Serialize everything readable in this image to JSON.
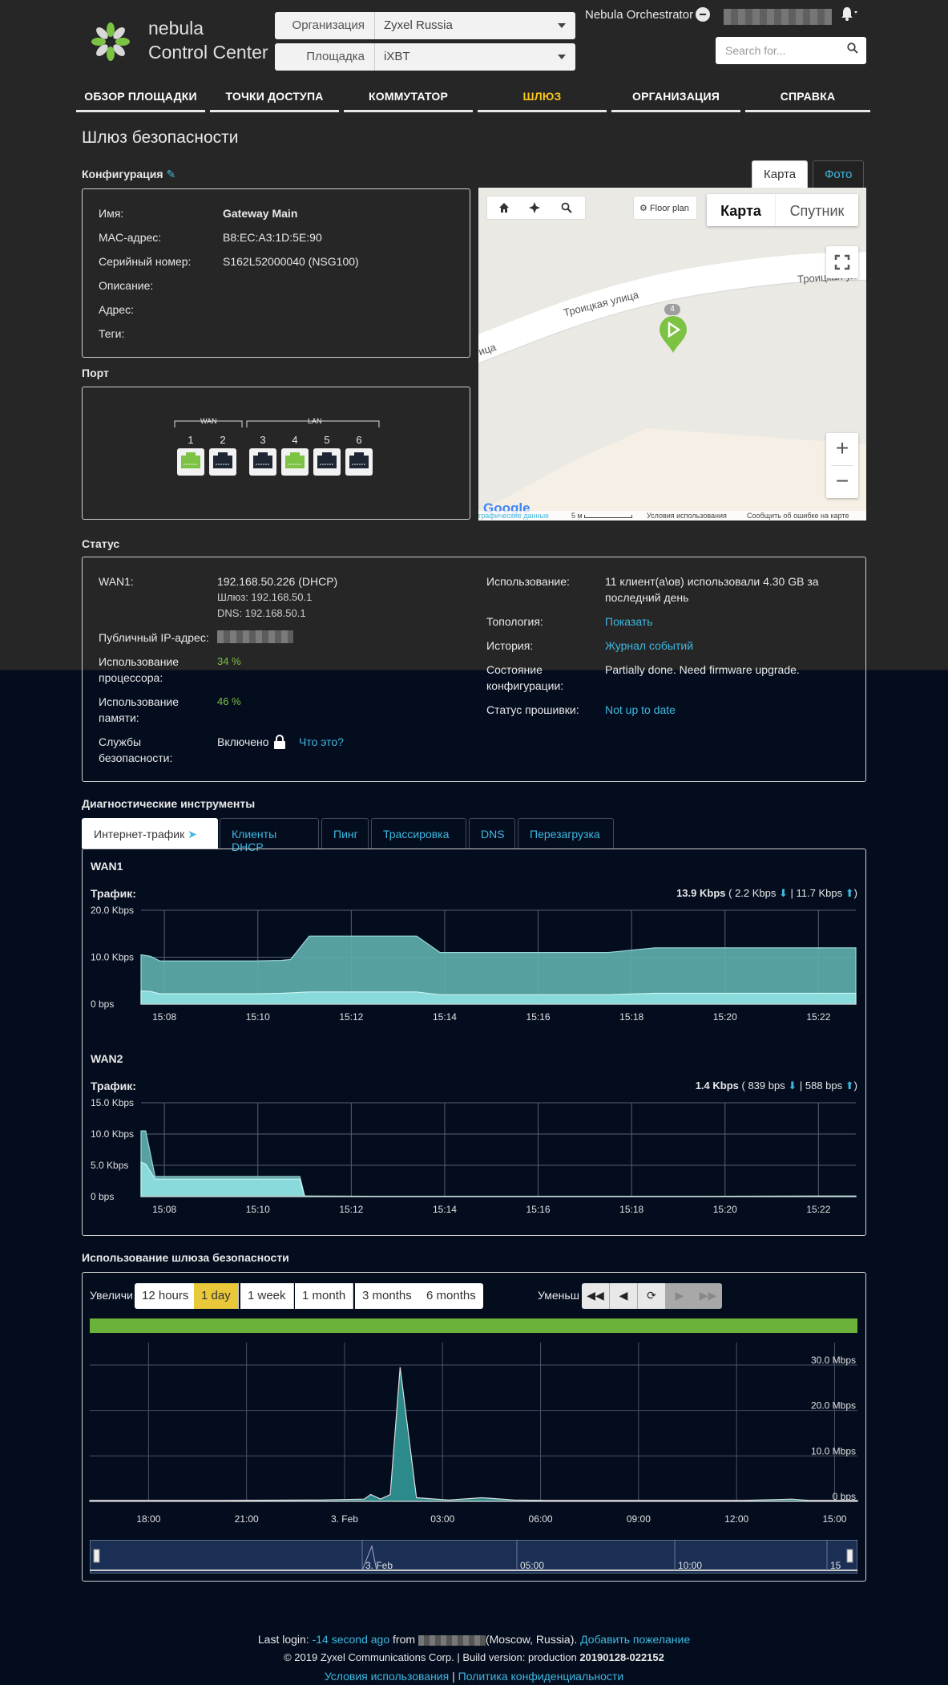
{
  "header": {
    "brand_line1": "nebula",
    "brand_line2": "Control Center",
    "org_label": "Организация",
    "org_value": "Zyxel Russia",
    "site_label": "Площадка",
    "site_value": "iXBT",
    "orchestrator_label": "Nebula Orchestrator",
    "search_placeholder": "Search for..."
  },
  "nav": [
    "ОБЗОР ПЛОЩАДКИ",
    "ТОЧКИ ДОСТУПА",
    "КОММУТАТОР",
    "ШЛЮЗ",
    "ОРГАНИЗАЦИЯ",
    "СПРАВКА"
  ],
  "nav_active_index": 3,
  "page_title": "Шлюз безопасности",
  "config": {
    "title": "Конфигурация",
    "rows": [
      {
        "k": "Имя:",
        "v": "Gateway Main"
      },
      {
        "k": "MAC-адрес:",
        "v": "B8:EC:A3:1D:5E:90"
      },
      {
        "k": "Серийный номер:",
        "v": "S162L52000040 (NSG100)"
      },
      {
        "k": "Описание:",
        "v": ""
      },
      {
        "k": "Адрес:",
        "v": ""
      },
      {
        "k": "Теги:",
        "v": ""
      }
    ]
  },
  "map_tabs": {
    "map": "Карта",
    "photo": "Фото"
  },
  "map": {
    "floor_plan": "Floor plan",
    "map_type": "Карта",
    "satellite": "Спутник",
    "street": "Троицкая улица",
    "street2": "Троицкая ул",
    "street3": "ица",
    "marker_count": "4",
    "zoom_in": "+",
    "zoom_out": "−",
    "attr_data": "графические данные",
    "scale": "5 м",
    "terms": "Условия использования",
    "report": "Сообщить об ошибке на карте",
    "google": "Google"
  },
  "ports": {
    "title": "Порт",
    "wan_label": "WAN",
    "lan_label": "LAN",
    "items": [
      {
        "num": "1",
        "status": "up"
      },
      {
        "num": "2",
        "status": "down"
      },
      {
        "num": "3",
        "status": "down"
      },
      {
        "num": "4",
        "status": "up"
      },
      {
        "num": "5",
        "status": "down"
      },
      {
        "num": "6",
        "status": "down"
      }
    ]
  },
  "status": {
    "title": "Статус",
    "wan1_label": "WAN1:",
    "wan1_ip": "192.168.50.226 (DHCP)",
    "gateway": "Шлюз: 192.168.50.1",
    "dns": "DNS: 192.168.50.1",
    "public_ip_label": "Публичный IP-адрес:",
    "cpu_label1": "Использование",
    "cpu_label2": "процессора:",
    "cpu_value": "34 %",
    "mem_label1": "Использование",
    "mem_label2": "памяти:",
    "mem_value": "46 %",
    "sec_label1": "Службы",
    "sec_label2": "безопасности:",
    "sec_value": "Включено",
    "sec_link": "Что это?",
    "usage_label": "Использование:",
    "usage_value1": "11 клиент(а\\ов) использовали 4.30 GB за",
    "usage_value2": "последний день",
    "topology_label": "Топология:",
    "topology_link": "Показать",
    "history_label": "История:",
    "history_link": "Журнал событий",
    "config_state_label1": "Состояние",
    "config_state_label2": "конфигурации:",
    "config_state_value": "Partially done. Need firmware upgrade.",
    "firmware_label": "Статус прошивки:",
    "firmware_link": "Not up to date"
  },
  "diag": {
    "title": "Диагностические инструменты",
    "tabs": [
      "Интернет-трафик",
      "Клиенты DHCP",
      "Пинг",
      "Трассировка",
      "DNS",
      "Перезагрузка"
    ],
    "active_tab": 0
  },
  "chart_data": [
    {
      "type": "area",
      "title": "WAN1",
      "subtitle": "Трафик:",
      "summary_total": "13.9 Kbps",
      "summary_down": "2.2 Kbps",
      "summary_up": "11.7 Kbps",
      "x_ticks": [
        "15:08",
        "15:10",
        "15:12",
        "15:14",
        "15:16",
        "15:18",
        "15:20",
        "15:22"
      ],
      "y_ticks": [
        "20.0 Kbps",
        "10.0 Kbps",
        "0 bps"
      ],
      "ylim": [
        0,
        20
      ],
      "unit": "Kbps",
      "x": [
        0,
        0.2,
        0.4,
        0.8,
        1.2,
        1.6,
        2.0,
        2.4,
        3.0,
        3.2,
        3.6,
        4.0,
        5.0,
        5.6,
        5.9,
        6.4,
        7.0,
        8.0,
        9.0,
        10.0,
        11.0,
        12.0,
        13.0,
        14.0,
        15.0,
        15.3
      ],
      "series": [
        {
          "values": [
            10.5,
            10.2,
            9.2,
            9.2,
            9.2,
            9.2,
            9.2,
            9.2,
            9.3,
            9.5,
            14.5,
            14.5,
            14.5,
            14.5,
            14.5,
            11.0,
            11.0,
            11.0,
            11.0,
            11.0,
            12.0,
            12.0,
            12.0,
            12.0,
            12.0,
            12.0
          ]
        },
        {
          "values": [
            2.8,
            2.7,
            2.2,
            2.2,
            2.2,
            2.2,
            2.2,
            2.2,
            2.3,
            2.4,
            2.6,
            2.6,
            2.6,
            2.6,
            2.6,
            2.0,
            2.0,
            2.0,
            2.0,
            2.0,
            2.3,
            2.3,
            2.3,
            2.3,
            2.3,
            2.3
          ]
        }
      ]
    },
    {
      "type": "area",
      "title": "WAN2",
      "subtitle": "Трафик:",
      "summary_total": "1.4 Kbps",
      "summary_down": "839 bps",
      "summary_up": "588 bps",
      "x_ticks": [
        "15:08",
        "15:10",
        "15:12",
        "15:14",
        "15:16",
        "15:18",
        "15:20",
        "15:22"
      ],
      "y_ticks": [
        "15.0 Kbps",
        "10.0 Kbps",
        "5.0 Kbps",
        "0 bps"
      ],
      "ylim": [
        0,
        15
      ],
      "unit": "Kbps",
      "x": [
        0,
        0.1,
        0.3,
        0.5,
        1.0,
        2.0,
        3.0,
        3.4,
        3.5,
        5.0,
        8.0,
        12.0,
        15.0,
        15.3
      ],
      "series": [
        {
          "values": [
            10.5,
            10.5,
            3.2,
            3.2,
            3.2,
            3.2,
            3.2,
            3.2,
            0.1,
            0.05,
            0.05,
            0.05,
            0.1,
            0.1
          ]
        },
        {
          "values": [
            5.5,
            5.2,
            2.8,
            2.8,
            2.8,
            2.8,
            2.8,
            2.8,
            0.05,
            0.02,
            0.02,
            0.02,
            0.05,
            0.05
          ]
        }
      ]
    },
    {
      "type": "area",
      "title": "Использование шлюза безопасности",
      "x_ticks": [
        "18:00",
        "21:00",
        "3. Feb",
        "03:00",
        "06:00",
        "09:00",
        "12:00",
        "15:00"
      ],
      "y_ticks": [
        "30.0 Mbps",
        "20.0 Mbps",
        "10.0 Mbps",
        "0 bps"
      ],
      "ylim": [
        0,
        30
      ],
      "unit": "Mbps",
      "series": [
        {
          "x_hours": [
            0,
            4,
            7,
            8.4,
            8.6,
            8.9,
            9.2,
            9.5,
            10,
            11,
            12,
            13,
            14,
            20,
            21.5,
            22,
            23.5
          ],
          "values": [
            0.2,
            0.2,
            0.3,
            0.5,
            1.5,
            0.5,
            1.5,
            29.5,
            0.8,
            0.3,
            0.8,
            0.3,
            0.2,
            0.2,
            0.5,
            0.2,
            0.2
          ]
        }
      ],
      "zoom_in_label": "Увеличи",
      "zoom_out_label": "Уменьш",
      "ranges": [
        "12 hours",
        "1 day",
        "1 week",
        "1 month",
        "3 months",
        "6 months"
      ],
      "active_range": 1,
      "nav_icons": [
        "first-icon",
        "prev-icon",
        "refresh-icon",
        "next-icon",
        "last-icon"
      ],
      "navigator_ticks": [
        "3. Feb",
        "05:00",
        "10:00",
        "15"
      ]
    }
  ],
  "footer": {
    "last_login": "Last login: ",
    "time_ago": "-14 second ago",
    "from": " from ",
    "location": "(Moscow, Russia).",
    "wish": "Добавить пожелание",
    "copyright": "© 2019 Zyxel Communications Corp.",
    "build_label": "| Build version: ",
    "build_env": "production",
    "build_version": "20190128-022152",
    "terms": "Условия использования",
    "sep": "|",
    "privacy": "Политика конфиденциальности"
  },
  "colors": {
    "accent_yellow": "#f5c518",
    "link_blue": "#3fb8e0",
    "green": "#7cc243",
    "area_dark": "#2c8a8a",
    "area_light": "#7fd9d9",
    "bg_top": "#262626",
    "bg_bottom": "#040d1e"
  }
}
